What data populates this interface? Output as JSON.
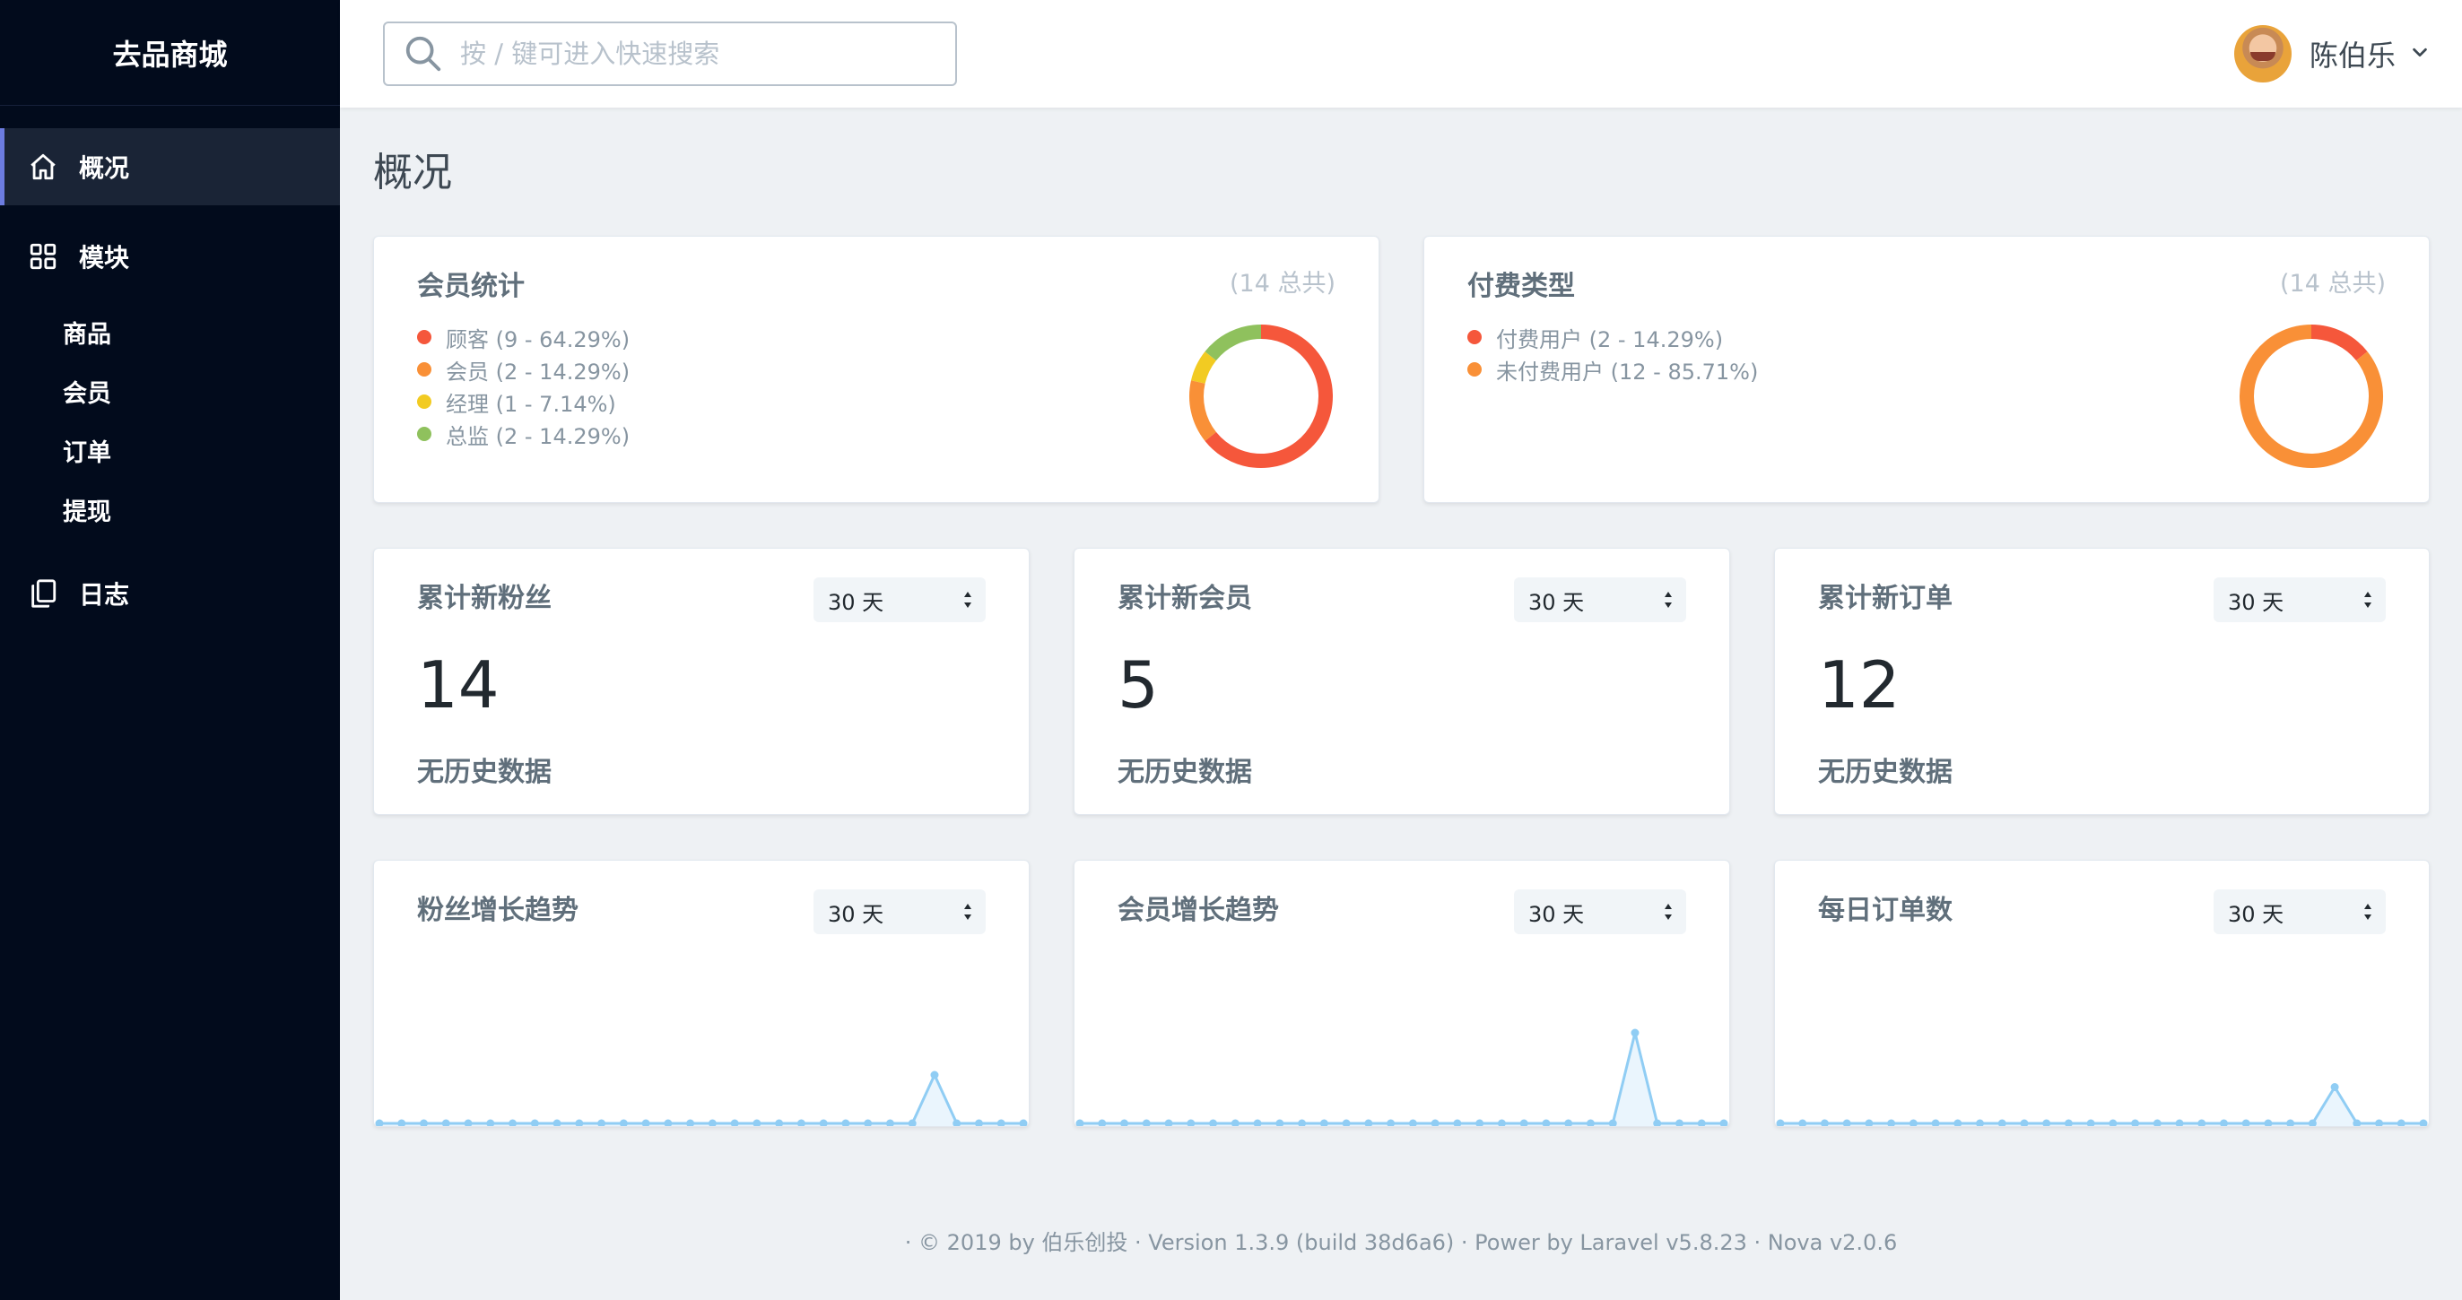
{
  "sidebar": {
    "brand": "去品商城",
    "nav": {
      "overview": "概况",
      "modules": "模块",
      "logs": "日志"
    },
    "sub_items": [
      "商品",
      "会员",
      "订单",
      "提现"
    ]
  },
  "header": {
    "search_placeholder": "按 / 键可进入快速搜索",
    "user_name": "陈伯乐"
  },
  "page": {
    "title": "概况"
  },
  "colors": {
    "red": "#f5573b",
    "orange": "#f99037",
    "yellow": "#f2cb22",
    "green": "#8fc15d",
    "trend": "#90cdf4"
  },
  "cards": {
    "member_stats": {
      "title": "会员统计",
      "total": "(14 总共)",
      "legend": [
        "顾客 (9 - 64.29%)",
        "会员 (2 - 14.29%)",
        "经理 (1 - 7.14%)",
        "总监 (2 - 14.29%)"
      ]
    },
    "pay_type": {
      "title": "付费类型",
      "total": "(14 总共)",
      "legend": [
        "付费用户 (2 - 14.29%)",
        "未付费用户 (12 - 85.71%)"
      ]
    },
    "fans_total": {
      "title": "累计新粉丝",
      "range": "30 天",
      "value": "14",
      "note": "无历史数据"
    },
    "members_total": {
      "title": "累计新会员",
      "range": "30 天",
      "value": "5",
      "note": "无历史数据"
    },
    "orders_total": {
      "title": "累计新订单",
      "range": "30 天",
      "value": "12",
      "note": "无历史数据"
    },
    "fans_trend": {
      "title": "粉丝增长趋势",
      "range": "30 天"
    },
    "members_trend": {
      "title": "会员增长趋势",
      "range": "30 天"
    },
    "orders_trend": {
      "title": "每日订单数",
      "range": "30 天"
    }
  },
  "chart_data": [
    {
      "type": "pie",
      "categories": [
        "顾客",
        "会员",
        "经理",
        "总监"
      ],
      "values": [
        9,
        2,
        1,
        2
      ],
      "colors": [
        "#f5573b",
        "#f99037",
        "#f2cb22",
        "#8fc15d"
      ]
    },
    {
      "type": "pie",
      "categories": [
        "付费用户",
        "未付费用户"
      ],
      "values": [
        2,
        12
      ],
      "colors": [
        "#f5573b",
        "#f99037"
      ]
    },
    {
      "type": "line",
      "x": [
        1,
        2,
        3,
        4,
        5,
        6,
        7,
        8,
        9,
        10,
        11,
        12,
        13,
        14,
        15,
        16,
        17,
        18,
        19,
        20,
        21,
        22,
        23,
        24,
        25,
        26,
        27,
        28,
        29,
        30
      ],
      "values": [
        0,
        0,
        0,
        0,
        0,
        0,
        0,
        0,
        0,
        0,
        0,
        0,
        0,
        0,
        0,
        0,
        0,
        0,
        0,
        0,
        0,
        0,
        0,
        0,
        0,
        14,
        0,
        0,
        0,
        0
      ],
      "ylim": [
        0,
        21
      ]
    },
    {
      "type": "line",
      "x": [
        1,
        2,
        3,
        4,
        5,
        6,
        7,
        8,
        9,
        10,
        11,
        12,
        13,
        14,
        15,
        16,
        17,
        18,
        19,
        20,
        21,
        22,
        23,
        24,
        25,
        26,
        27,
        28,
        29,
        30
      ],
      "values": [
        0,
        0,
        0,
        0,
        0,
        0,
        0,
        0,
        0,
        0,
        0,
        0,
        0,
        0,
        0,
        0,
        0,
        0,
        0,
        0,
        0,
        0,
        0,
        0,
        0,
        5,
        0,
        0,
        0,
        0
      ],
      "ylim": [
        0,
        5
      ]
    },
    {
      "type": "line",
      "x": [
        1,
        2,
        3,
        4,
        5,
        6,
        7,
        8,
        9,
        10,
        11,
        12,
        13,
        14,
        15,
        16,
        17,
        18,
        19,
        20,
        21,
        22,
        23,
        24,
        25,
        26,
        27,
        28,
        29,
        30
      ],
      "values": [
        0,
        0,
        0,
        0,
        0,
        0,
        0,
        0,
        0,
        0,
        0,
        0,
        0,
        0,
        0,
        0,
        0,
        0,
        0,
        0,
        0,
        0,
        0,
        0,
        0,
        12,
        0,
        0,
        0,
        0
      ],
      "ylim": [
        0,
        24
      ]
    }
  ],
  "footer": {
    "text": "· © 2019 by 伯乐创投 · Version 1.3.9 (build 38d6a6) · Power by Laravel v5.8.23 · Nova v2.0.6"
  }
}
